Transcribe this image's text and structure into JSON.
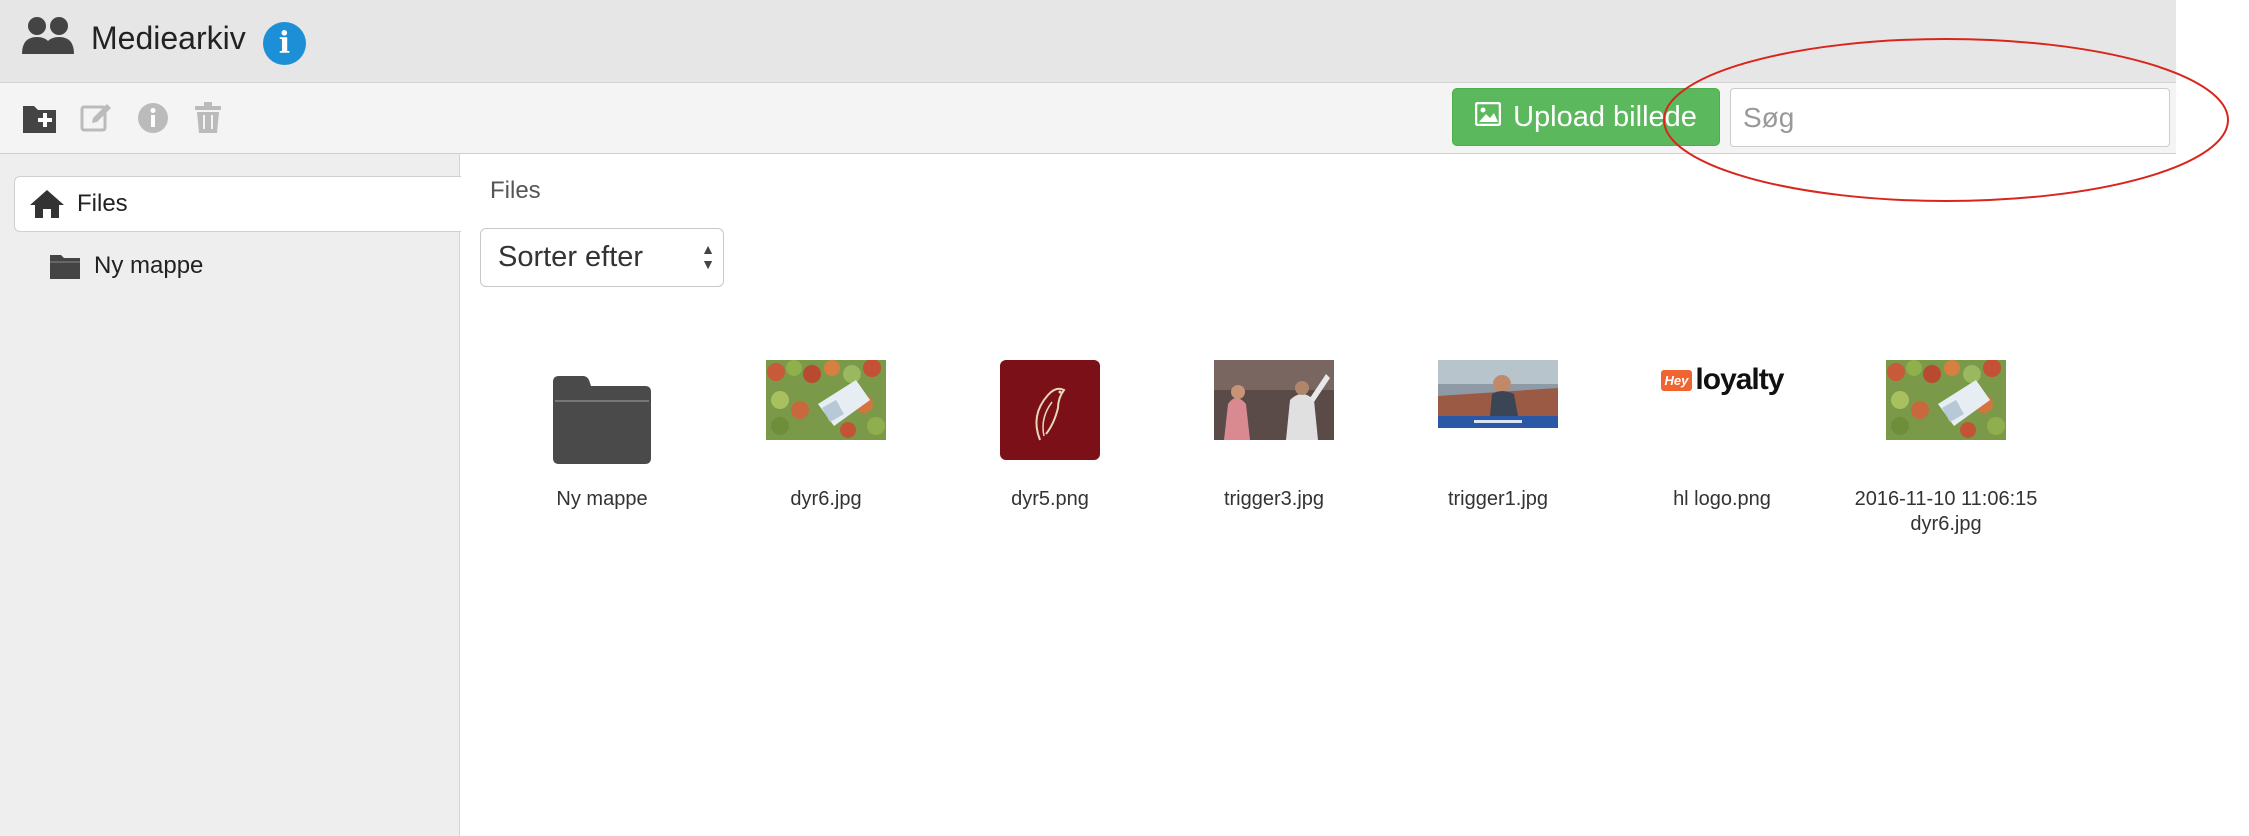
{
  "app": {
    "title": "Mediearkiv",
    "info_glyph": "i"
  },
  "toolbar": {
    "icons": [
      "new-folder-icon",
      "edit-icon",
      "info-icon",
      "trash-icon"
    ],
    "upload_label": "Upload billede",
    "search_placeholder": "Søg"
  },
  "sidebar": {
    "root_label": "Files",
    "children": [
      {
        "label": "Ny mappe"
      }
    ]
  },
  "main": {
    "breadcrumb": "Files",
    "sort_label": "Sorter efter",
    "items": [
      {
        "label": "Ny mappe",
        "kind": "folder"
      },
      {
        "label": "dyr6.jpg",
        "kind": "image"
      },
      {
        "label": "dyr5.png",
        "kind": "image"
      },
      {
        "label": "trigger3.jpg",
        "kind": "image"
      },
      {
        "label": "trigger1.jpg",
        "kind": "image"
      },
      {
        "label": "hl logo.png",
        "kind": "image",
        "logo_text": "loyalty",
        "logo_badge": "Hey"
      },
      {
        "label": "2016-11-10 11:06:15 dyr6.jpg",
        "kind": "image"
      }
    ]
  },
  "colors": {
    "accent": "#5cb85c",
    "info_badge": "#1d8fd6",
    "annotation": "#d9261c"
  }
}
